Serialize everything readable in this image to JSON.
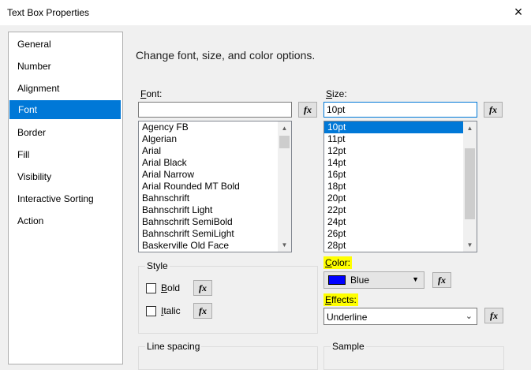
{
  "window": {
    "title": "Text Box Properties",
    "close_icon": "×"
  },
  "nav": {
    "items": [
      {
        "label": "General"
      },
      {
        "label": "Number"
      },
      {
        "label": "Alignment"
      },
      {
        "label": "Font",
        "selected": true
      },
      {
        "label": "Border"
      },
      {
        "label": "Fill"
      },
      {
        "label": "Visibility"
      },
      {
        "label": "Interactive Sorting"
      },
      {
        "label": "Action"
      }
    ]
  },
  "main": {
    "heading": "Change font, size, and color options.",
    "font": {
      "label_pre": "",
      "label_key": "F",
      "label_post": "ont:",
      "value": "",
      "options": [
        "Agency FB",
        "Algerian",
        "Arial",
        "Arial Black",
        "Arial Narrow",
        "Arial Rounded MT Bold",
        "Bahnschrift",
        "Bahnschrift Light",
        "Bahnschrift SemiBold",
        "Bahnschrift SemiLight",
        "Baskerville Old Face"
      ]
    },
    "size": {
      "label_pre": "",
      "label_key": "S",
      "label_post": "ize:",
      "value": "10pt",
      "options": [
        "10pt",
        "11pt",
        "12pt",
        "14pt",
        "16pt",
        "18pt",
        "20pt",
        "22pt",
        "24pt",
        "26pt",
        "28pt"
      ],
      "selected": "10pt"
    },
    "fx_label": "fx",
    "style": {
      "title": "Style",
      "bold_key": "B",
      "bold_rest": "old",
      "italic_key": "I",
      "italic_rest": "talic",
      "bold_checked": false,
      "italic_checked": false
    },
    "color": {
      "label_key": "C",
      "label_rest": "olor:",
      "value": "Blue",
      "swatch": "#0000ff"
    },
    "effects": {
      "label_key": "E",
      "label_rest": "ffects:",
      "value": "Underline"
    },
    "line_spacing": {
      "title": "Line spacing"
    },
    "sample": {
      "title": "Sample"
    }
  },
  "colors": {
    "accent": "#0078d7",
    "highlight": "#ffff00"
  }
}
